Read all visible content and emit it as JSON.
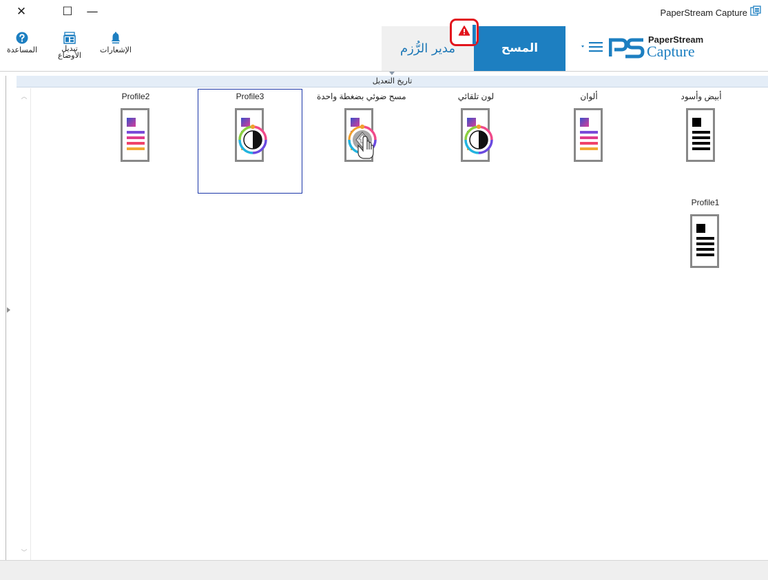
{
  "window": {
    "title": "PaperStream Capture",
    "controls": {
      "close": "✕",
      "maximize": "☐",
      "minimize": "—"
    }
  },
  "ribbon": {
    "help_label": "المساعدة",
    "switch_mode_label_1": "تبديل",
    "switch_mode_label_2": "الأوضاع",
    "notifications_label": "الإشعارات"
  },
  "tabs": {
    "batch_manager": "مدير الرُّزم",
    "scan": "المسح"
  },
  "logo": {
    "line1": "PaperStream",
    "line2": "Capture"
  },
  "sort_bar": {
    "label": "تاريخ التعديل"
  },
  "profiles": [
    {
      "label": "أبيض وأسود",
      "icon": "bw-document-icon"
    },
    {
      "label": "ألوان",
      "icon": "color-document-icon"
    },
    {
      "label": "لون تلقائي",
      "icon": "auto-color-document-icon"
    },
    {
      "label": "مسح ضوئي بضغطة واحدة",
      "icon": "one-touch-scan-document-icon"
    },
    {
      "label": "Profile3",
      "icon": "auto-color-document-icon"
    },
    {
      "label": "Profile2",
      "icon": "color-document-icon"
    },
    {
      "label": "Profile1",
      "icon": "bw-document-icon"
    }
  ],
  "colors": {
    "accent": "#1d7fc1",
    "tab_text": "#1c77b6",
    "warning": "#e2141c",
    "selection_border": "#1a36a8",
    "sort_bar_bg": "#e4edf7"
  }
}
